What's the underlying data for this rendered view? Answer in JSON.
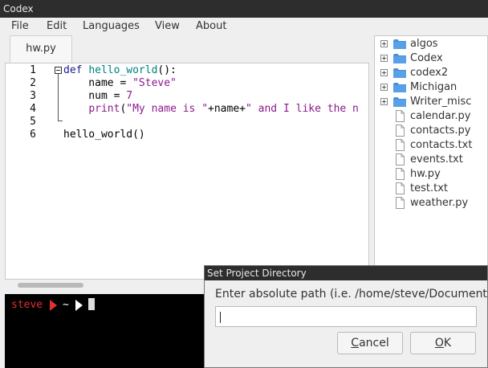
{
  "window": {
    "title": "Codex"
  },
  "menubar": {
    "items": [
      "File",
      "Edit",
      "Languages",
      "View",
      "About"
    ]
  },
  "editor": {
    "tab": "hw.py",
    "lines": [
      {
        "number": "1",
        "segments": [
          {
            "text": "def ",
            "cls": "kw"
          },
          {
            "text": "hello_world",
            "cls": "fn"
          },
          {
            "text": "():",
            "cls": ""
          }
        ]
      },
      {
        "number": "2",
        "segments": [
          {
            "text": "    name = ",
            "cls": ""
          },
          {
            "text": "\"Steve\"",
            "cls": "str"
          }
        ]
      },
      {
        "number": "3",
        "segments": [
          {
            "text": "    num = ",
            "cls": ""
          },
          {
            "text": "7",
            "cls": "num"
          }
        ]
      },
      {
        "number": "4",
        "segments": [
          {
            "text": "    ",
            "cls": ""
          },
          {
            "text": "print",
            "cls": "str"
          },
          {
            "text": "(",
            "cls": ""
          },
          {
            "text": "\"My name is \"",
            "cls": "str"
          },
          {
            "text": "+name+",
            "cls": ""
          },
          {
            "text": "\" and I like the n",
            "cls": "str"
          }
        ]
      },
      {
        "number": "5",
        "segments": []
      },
      {
        "number": "6",
        "segments": [
          {
            "text": "hello_world()",
            "cls": ""
          }
        ]
      }
    ]
  },
  "terminal": {
    "user": "steve",
    "cwd": "~"
  },
  "filetree": {
    "folders": [
      "algos",
      "Codex",
      "codex2",
      "Michigan",
      "Writer_misc"
    ],
    "files": [
      "calendar.py",
      "contacts.py",
      "contacts.txt",
      "events.txt",
      "hw.py",
      "test.txt",
      "weather.py"
    ]
  },
  "dialog": {
    "title": "Set Project Directory",
    "prompt": "Enter absolute path (i.e. /home/steve/Documents)",
    "input_value": "",
    "cancel_label": "Cancel",
    "ok_label": "OK"
  },
  "colors": {
    "folder": "#4a90d9",
    "terminal_red": "#e03030",
    "titlebar": "#2d2d2d"
  },
  "icons": {
    "folder": "folder-icon",
    "file": "file-icon",
    "expand": "expand-plus-icon"
  }
}
